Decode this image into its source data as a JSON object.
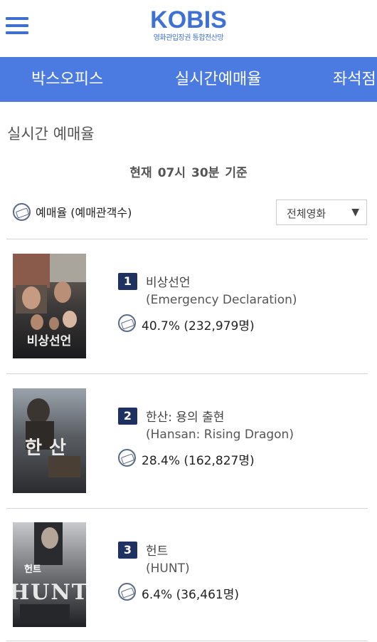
{
  "header": {
    "logo_text": "KOBIS",
    "logo_sub": "영화관입장권 통합전산망"
  },
  "tabs": [
    {
      "label": "박스오피스"
    },
    {
      "label": "실시간예매율"
    },
    {
      "label": "좌석점"
    }
  ],
  "page": {
    "title": "실시간 예매율",
    "asof": {
      "label": "현재",
      "hour": "07시",
      "minute": "30분",
      "suffix": "기준"
    }
  },
  "legend": {
    "icon": "ticket-icon",
    "label": "예매율 (예매관객수)"
  },
  "filter": {
    "selected": "전체영화",
    "caret": "▼"
  },
  "movies": [
    {
      "rank": "1",
      "title_ko": "비상선언",
      "title_en": "(Emergency Declaration)",
      "rate": "40.7% (232,979명)",
      "poster_text": "비상선언"
    },
    {
      "rank": "2",
      "title_ko": "한산: 용의 출현",
      "title_en": "(Hansan: Rising Dragon)",
      "rate": "28.4% (162,827명)",
      "poster_text": "한산"
    },
    {
      "rank": "3",
      "title_ko": "헌트",
      "title_en": "(HUNT)",
      "rate": "6.4% (36,461명)",
      "poster_text": "HUNT",
      "poster_text_ko": "헌트"
    }
  ],
  "colors": {
    "brand": "#3e71d6",
    "tab_bar": "#4b7be0",
    "rank_badge": "#1f3160"
  }
}
